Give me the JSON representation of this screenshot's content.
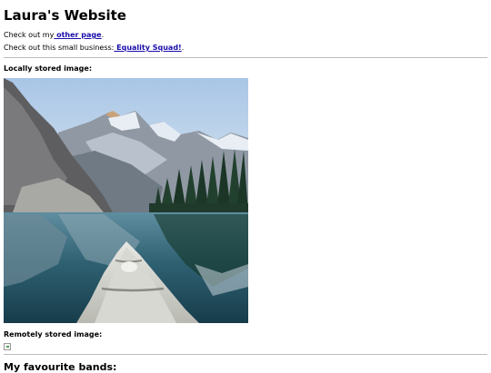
{
  "header": {
    "title": "Laura's Website"
  },
  "intro": {
    "other_page_prefix": "Check out my",
    "other_page_link": " other page",
    "other_page_suffix": ".",
    "business_prefix": "Check out this small business:",
    "business_link": " Equality Squad!",
    "business_suffix": "."
  },
  "images": {
    "local_label": "Locally stored image:",
    "remote_label": "Remotely stored image:"
  },
  "bands": {
    "heading": "My favourite bands:"
  },
  "colors": {
    "link": "#1a0dab",
    "rule": "#bdbdbd"
  }
}
